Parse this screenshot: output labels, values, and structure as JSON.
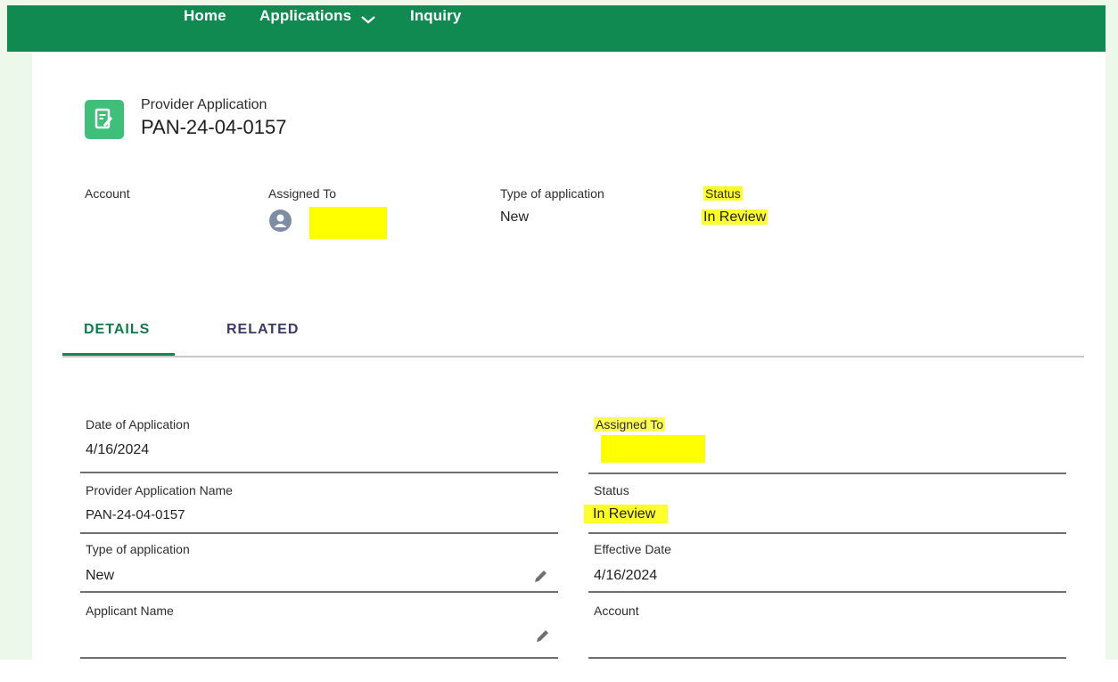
{
  "nav": {
    "items": [
      {
        "label": "Home"
      },
      {
        "label": "Applications"
      },
      {
        "label": "Inquiry"
      }
    ]
  },
  "header": {
    "object_label": "Provider Application",
    "title": "PAN-24-04-0157"
  },
  "highlights": {
    "account_label": "Account",
    "assigned_to_label": "Assigned To",
    "type_label": "Type of application",
    "type_value": "New",
    "status_label": "Status",
    "status_value": "In Review"
  },
  "tabs": [
    {
      "label": "DETAILS",
      "active": true
    },
    {
      "label": "RELATED",
      "active": false
    }
  ],
  "details": {
    "left": [
      {
        "label": "Date of Application",
        "value": "4/16/2024"
      },
      {
        "label": "Provider Application Name",
        "value": "PAN-24-04-0157"
      },
      {
        "label": "Type of application",
        "value": "New"
      },
      {
        "label": "Applicant Name",
        "value": ""
      }
    ],
    "right": [
      {
        "label": "Assigned To",
        "value": ""
      },
      {
        "label": "Status",
        "value": "In Review"
      },
      {
        "label": "Effective Date",
        "value": "4/16/2024"
      },
      {
        "label": "Account",
        "value": ""
      }
    ]
  },
  "colors": {
    "nav_bg": "#118a51",
    "highlight": "#ffff00",
    "icon_bg": "#3fbf7a"
  }
}
